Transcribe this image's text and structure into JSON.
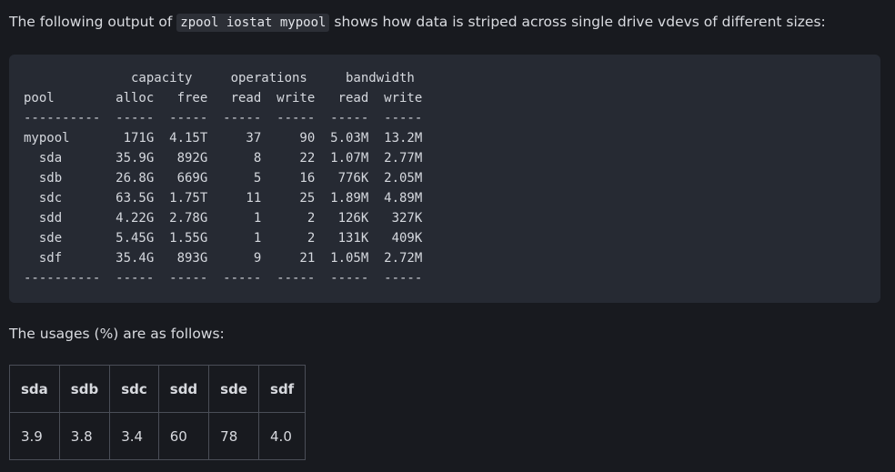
{
  "intro": {
    "before": "The following output of ",
    "command": "zpool iostat mypool",
    "after": " shows how data is striped across single drive vdevs of different sizes:"
  },
  "iostat": {
    "header1": "              capacity     operations     bandwidth",
    "header2": "pool        alloc   free   read  write   read  write",
    "sep": "----------  -----  -----  -----  -----  -----  -----",
    "rows": [
      "mypool       171G  4.15T     37     90  5.03M  13.2M",
      "  sda       35.9G   892G      8     22  1.07M  2.77M",
      "  sdb       26.8G   669G      5     16   776K  2.05M",
      "  sdc       63.5G  1.75T     11     25  1.89M  4.89M",
      "  sdd       4.22G  2.78G      1      2   126K   327K",
      "  sde       5.45G  1.55G      1      2   131K   409K",
      "  sdf       35.4G   893G      9     21  1.05M  2.72M"
    ]
  },
  "usage_label": "The usages (%) are as follows:",
  "usage_table": {
    "headers": [
      "sda",
      "sdb",
      "sdc",
      "sdd",
      "sde",
      "sdf"
    ],
    "values": [
      "3.9",
      "3.8",
      "3.4",
      "60",
      "78",
      "4.0"
    ]
  }
}
